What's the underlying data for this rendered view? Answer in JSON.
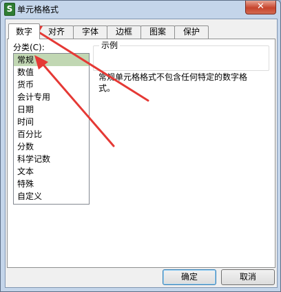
{
  "window": {
    "title": "单元格格式",
    "app_icon_letter": "S",
    "close_glyph": "✕"
  },
  "tabs": [
    {
      "label": "数字",
      "active": true
    },
    {
      "label": "对齐"
    },
    {
      "label": "字体"
    },
    {
      "label": "边框"
    },
    {
      "label": "图案"
    },
    {
      "label": "保护"
    }
  ],
  "category": {
    "label": "分类(C):",
    "items": [
      "常规",
      "数值",
      "货币",
      "会计专用",
      "日期",
      "时间",
      "百分比",
      "分数",
      "科学记数",
      "文本",
      "特殊",
      "自定义"
    ],
    "selected": "常规"
  },
  "preview": {
    "label": "示例",
    "value": ""
  },
  "description": "常规单元格格式不包含任何特定的数字格式。",
  "buttons": {
    "ok": "确定",
    "cancel": "取消"
  },
  "annotation": {
    "arrow_color": "#e53935",
    "arrow_targets": [
      "tab-number",
      "list-item-general"
    ]
  }
}
